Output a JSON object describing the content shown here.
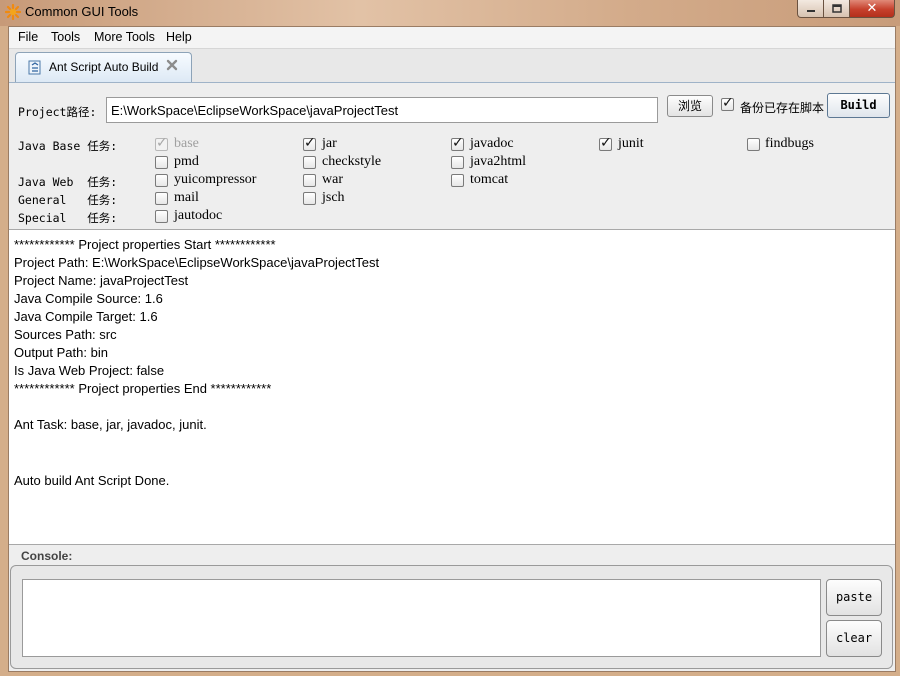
{
  "window": {
    "title": "Common GUI Tools"
  },
  "menu": {
    "items": [
      "File",
      "Tools",
      "More Tools",
      "Help"
    ]
  },
  "tab": {
    "label": "Ant Script Auto Build"
  },
  "project": {
    "label": "Project路径:",
    "path": "E:\\WorkSpace\\EclipseWorkSpace\\javaProjectTest",
    "browse_label": "浏览",
    "backup_label": "备份已存在脚本",
    "backup_checked": true,
    "build_label": "Build"
  },
  "tasks": {
    "java_base_label": "Java Base 任务:",
    "java_web_label": "Java Web  任务:",
    "general_label": "General   任务:",
    "special_label": "Special   任务:",
    "items": [
      {
        "label": "base",
        "checked": true,
        "disabled": true
      },
      {
        "label": "jar",
        "checked": true
      },
      {
        "label": "javadoc",
        "checked": true
      },
      {
        "label": "junit",
        "checked": true
      },
      {
        "label": "findbugs",
        "checked": false
      },
      {
        "label": "pmd",
        "checked": false
      },
      {
        "label": "checkstyle",
        "checked": false
      },
      {
        "label": "java2html",
        "checked": false
      },
      {
        "label": "yuicompressor",
        "checked": false
      },
      {
        "label": "war",
        "checked": false
      },
      {
        "label": "tomcat",
        "checked": false
      },
      {
        "label": "mail",
        "checked": false
      },
      {
        "label": "jsch",
        "checked": false
      },
      {
        "label": "jautodoc",
        "checked": false
      }
    ]
  },
  "output": {
    "lines": [
      "************ Project properties Start ************",
      "Project Path: E:\\WorkSpace\\EclipseWorkSpace\\javaProjectTest",
      "Project Name: javaProjectTest",
      "Java Compile Source: 1.6",
      "Java Compile Target: 1.6",
      "Sources Path: src",
      "Output Path: bin",
      "Is Java Web Project: false",
      "************ Project properties End ************",
      "",
      "Ant Task: base, jar, javadoc, junit.",
      "",
      "",
      "Auto build Ant Script Done."
    ]
  },
  "console": {
    "label": "Console:",
    "value": "",
    "paste_label": "paste",
    "clear_label": "clear"
  }
}
